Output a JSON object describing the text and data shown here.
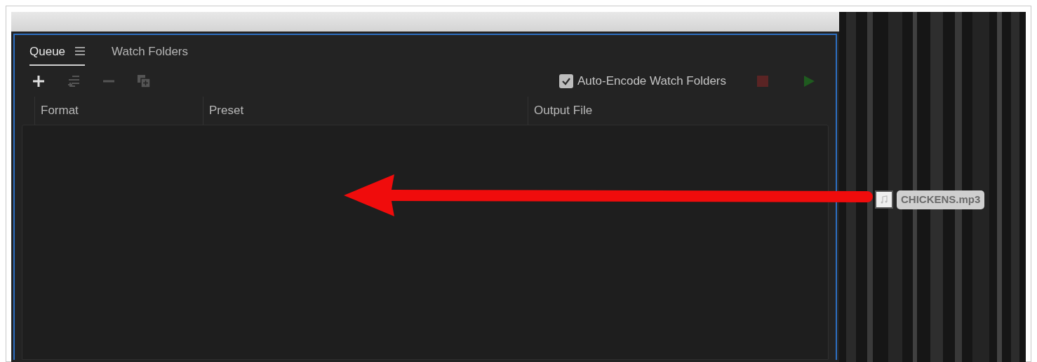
{
  "tabs": [
    {
      "label": "Queue",
      "selected": true,
      "menu_icon": true
    },
    {
      "label": "Watch Folders",
      "selected": false,
      "menu_icon": false
    }
  ],
  "toolbar": [
    {
      "kind": "add",
      "disabled": false
    },
    {
      "kind": "settings",
      "disabled": true
    },
    {
      "kind": "remove",
      "disabled": true
    },
    {
      "kind": "duplicate",
      "disabled": true
    }
  ],
  "auto_encode": {
    "label": "Auto-Encode Watch Folders",
    "checked": true
  },
  "controls": [
    {
      "kind": "stop",
      "disabled": true
    },
    {
      "kind": "start",
      "disabled": true
    }
  ],
  "columns": [
    "Format",
    "Preset",
    "Output File"
  ],
  "dragged_file": {
    "name": "CHICKENS.mp3"
  }
}
